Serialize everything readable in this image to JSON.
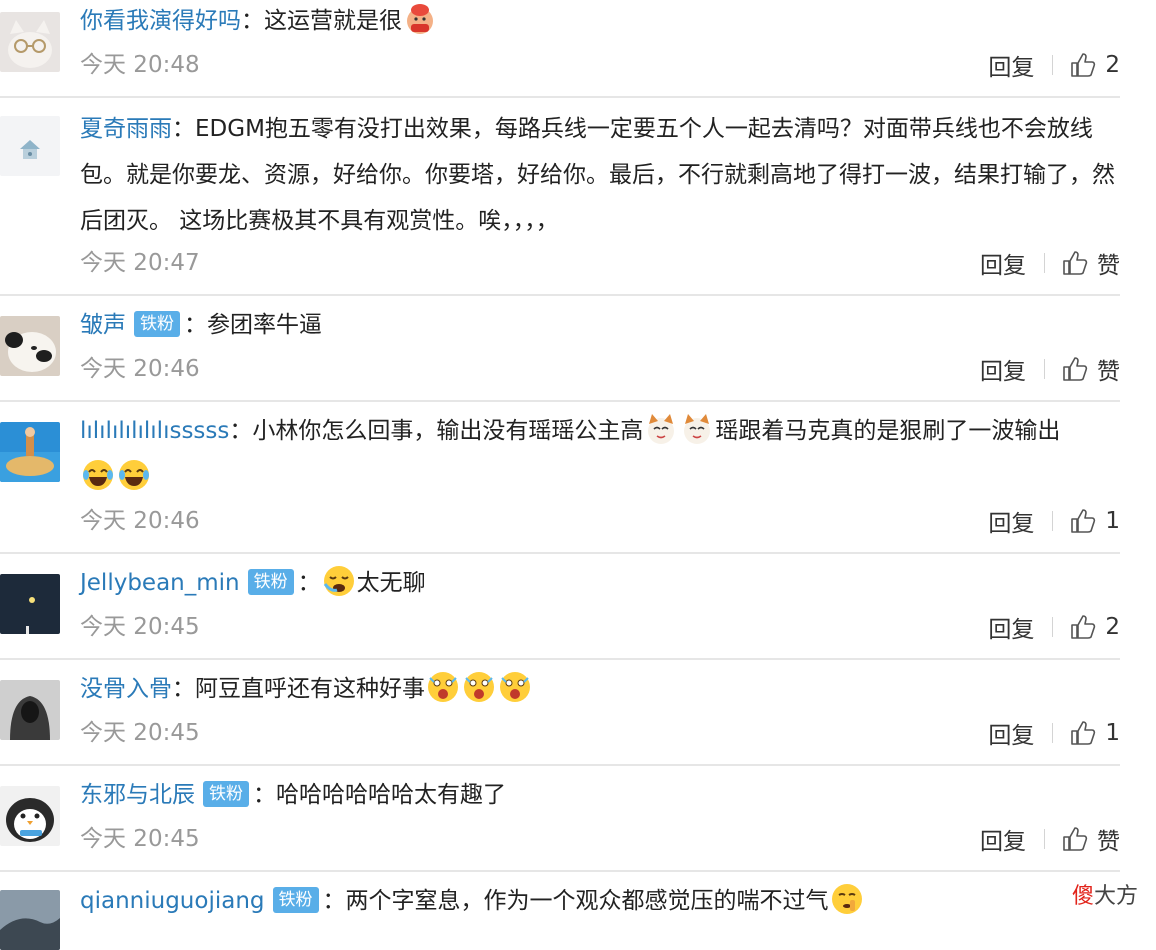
{
  "comments": [
    {
      "user": "你看我演得好吗",
      "badge": "",
      "sep": "：",
      "text": "这运营就是很",
      "text_after": "",
      "time": "今天 20:48",
      "reply": "回复",
      "likes": "2",
      "avatar": "cat-avatar-icon"
    },
    {
      "user": "夏奇雨雨",
      "badge": "",
      "sep": "：",
      "text": "EDGM抱五零有没打出效果，每路兵线一定要五个人一起去清吗？对面带兵线也不会放线包。就是你要龙、资源，好给你。你要塔，好给你。最后，不行就剩高地了得打一波，结果打输了，然后团灭。 这场比赛极其不具有观赏性。唉，，，，",
      "text_after": "",
      "time": "今天 20:47",
      "reply": "回复",
      "likes": "赞",
      "avatar": "house-avatar-icon"
    },
    {
      "user": "皱声",
      "badge": "铁粉",
      "sep": "：",
      "text": "参团率牛逼",
      "text_after": "",
      "time": "今天 20:46",
      "reply": "回复",
      "likes": "赞",
      "avatar": "panda-avatar-icon"
    },
    {
      "user": "lılılılılılılısssss",
      "badge": "",
      "sep": "：",
      "text": "小林你怎么回事，输出没有瑶瑶公主高",
      "text_after": "瑶跟着马克真的是狠刷了一波输出",
      "time": "今天 20:46",
      "reply": "回复",
      "likes": "1",
      "avatar": "beach-avatar-icon"
    },
    {
      "user": "Jellybean_min",
      "badge": "铁粉",
      "sep": "：",
      "text": "太无聊",
      "text_after": "",
      "time": "今天 20:45",
      "reply": "回复",
      "likes": "2",
      "avatar": "night-avatar-icon"
    },
    {
      "user": "没骨入骨",
      "badge": "",
      "sep": "：",
      "text": "阿豆直呼还有这种好事",
      "text_after": "",
      "time": "今天 20:45",
      "reply": "回复",
      "likes": "1",
      "avatar": "hooded-avatar-icon"
    },
    {
      "user": "东邪与北辰",
      "badge": "铁粉",
      "sep": "：",
      "text": "哈哈哈哈哈哈太有趣了",
      "text_after": "",
      "time": "今天 20:45",
      "reply": "回复",
      "likes": "赞",
      "avatar": "penguin-avatar-icon"
    },
    {
      "user": "qianniuguojiang",
      "badge": "铁粉",
      "sep": "：",
      "text": "两个字窒息，作为一个观众都感觉压的喘不过气",
      "text_after": "",
      "avatar": "sky-avatar-icon"
    }
  ],
  "watermark": {
    "red": "傻",
    "rest": "大方"
  },
  "colors": {
    "username": "#2a7ab8",
    "badge": "#59aee8",
    "time": "#999999"
  }
}
